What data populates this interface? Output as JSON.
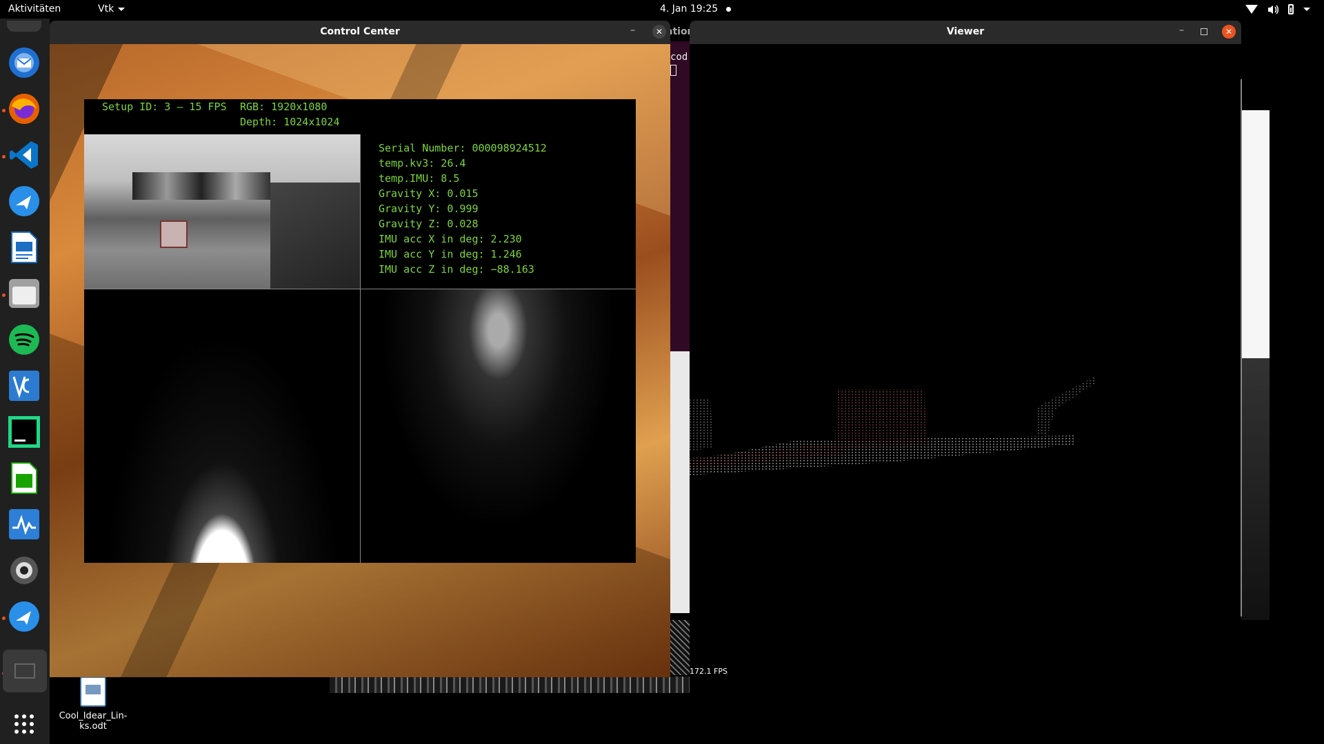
{
  "topbar": {
    "activities": "Aktivitäten",
    "app_menu": "Vtk",
    "clock": "4. Jan  19:25",
    "tray_icons": [
      "wifi-icon",
      "volume-icon",
      "battery-icon",
      "chevron-down-icon"
    ]
  },
  "dock": {
    "items": [
      {
        "name": "thunderbird",
        "icon": "mail-icon",
        "color": "#1f6fd1",
        "running": false
      },
      {
        "name": "firefox",
        "icon": "firefox-icon",
        "color": "#e66000",
        "running": true
      },
      {
        "name": "vscode",
        "icon": "code-icon",
        "color": "#0a75c9",
        "running": true
      },
      {
        "name": "app-plane-1",
        "icon": "plane-icon",
        "color": "#2a8fe8",
        "running": false
      },
      {
        "name": "writer",
        "icon": "document-icon",
        "color": "#1b6ec2",
        "running": false
      },
      {
        "name": "files",
        "icon": "folder-icon",
        "color": "#a0a0a0",
        "running": true
      },
      {
        "name": "spotify",
        "icon": "spotify-icon",
        "color": "#1db954",
        "running": false
      },
      {
        "name": "vnc",
        "icon": "vnc-icon",
        "color": "#2c7bd1",
        "running": false
      },
      {
        "name": "pycharm",
        "icon": "pycharm-icon",
        "color": "#21d789",
        "running": false
      },
      {
        "name": "calc",
        "icon": "spreadsheet-icon",
        "color": "#18a303",
        "running": false
      },
      {
        "name": "monitor",
        "icon": "system-monitor-icon",
        "color": "#2d7fd8",
        "running": false
      },
      {
        "name": "eye",
        "icon": "eye-icon",
        "color": "#888888",
        "running": false
      },
      {
        "name": "app-plane-2",
        "icon": "plane-icon",
        "color": "#2a8fe8",
        "running": true
      },
      {
        "name": "vtk",
        "icon": "window-icon",
        "color": "#3a3a3a",
        "running": true
      }
    ],
    "show_apps_icon": "grid-icon"
  },
  "desktop": {
    "file_label": "Cool_Idear_Lin-ks.odt"
  },
  "control_center": {
    "title": "Control Center",
    "min_label": "–",
    "close_label": "✕",
    "setup_line": "Setup ID: 3 – 15 FPS",
    "rgb_line": "RGB: 1920x1080",
    "depth_line": "Depth: 1024x1024",
    "info_lines": [
      "Serial Number: 000098924512",
      "temp.kv3: 26.4",
      "temp.IMU: 8.5",
      "Gravity X: 0.015",
      "Gravity Y: 0.999",
      "Gravity Z: 0.028",
      "IMU acc X in deg: 2.230",
      "IMU acc Y in deg: 1.246",
      "IMU acc Z in deg: −88.163"
    ],
    "text_color": "#7cd63a"
  },
  "background_window": {
    "tab_text": "ation",
    "terminal_text": "cod"
  },
  "viewer": {
    "title": "Viewer",
    "min_label": "–",
    "close_label": "✕",
    "fps": "172.1 FPS"
  }
}
